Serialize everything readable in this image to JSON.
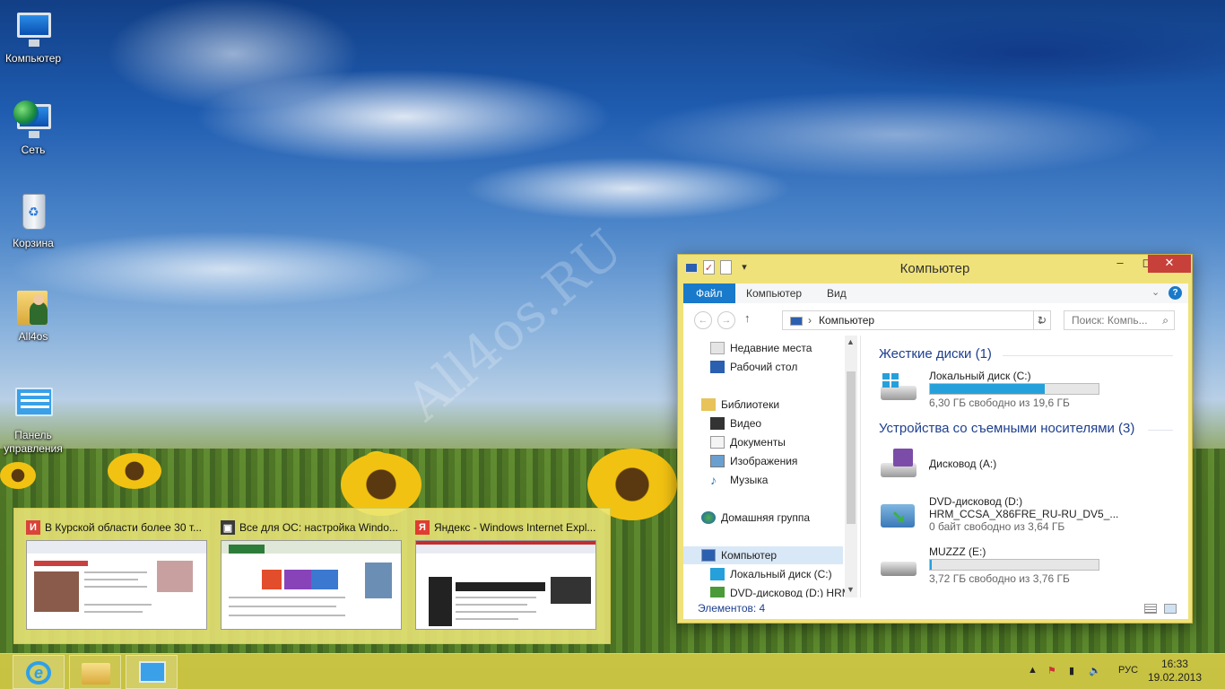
{
  "desktop": {
    "icons": [
      {
        "label": "Компьютер"
      },
      {
        "label": "Сеть"
      },
      {
        "label": "Корзина"
      },
      {
        "label": "All4os"
      },
      {
        "label": "Панель управления"
      }
    ],
    "watermark": "All4os.RU"
  },
  "thumbnails": [
    {
      "title": "В Курской области более 30 т...",
      "icon": "news-icon",
      "icon_color": "#d9433a"
    },
    {
      "title": "Все для ОС: настройка Windo...",
      "icon": "monitor-icon",
      "icon_color": "#3a3a3a"
    },
    {
      "title": "Яндекс - Windows Internet Expl...",
      "icon": "yandex-icon",
      "icon_color": "#e03c31"
    }
  ],
  "explorer": {
    "title": "Компьютер",
    "ribbon_tabs": [
      "Файл",
      "Компьютер",
      "Вид"
    ],
    "address": "Компьютер",
    "search_placeholder": "Поиск: Компь...",
    "nav": [
      {
        "label": "Недавние места"
      },
      {
        "label": "Рабочий стол"
      },
      {
        "label": "Библиотеки"
      },
      {
        "label": "Видео"
      },
      {
        "label": "Документы"
      },
      {
        "label": "Изображения"
      },
      {
        "label": "Музыка"
      },
      {
        "label": "Домашняя группа"
      },
      {
        "label": "Компьютер"
      },
      {
        "label": "Локальный диск (C:)"
      },
      {
        "label": "DVD-дисковод (D:) HRM"
      }
    ],
    "groups": {
      "hard": "Жесткие диски (1)",
      "removable": "Устройства со съемными носителями (3)"
    },
    "drives": [
      {
        "name": "Локальный диск (C:)",
        "free": "6,30 ГБ свободно из 19,6 ГБ",
        "used_fraction": 0.68
      },
      {
        "name": "Дисковод (A:)"
      },
      {
        "name": "DVD-дисковод (D:)",
        "label": "HRM_CCSA_X86FRE_RU-RU_DV5_...",
        "free": "0 байт свободно из 3,64 ГБ"
      },
      {
        "name": "MUZZZ (E:)",
        "free": "3,72 ГБ свободно из 3,76 ГБ",
        "used_fraction": 0.01
      }
    ],
    "status": "Элементов: 4"
  },
  "taskbar": {
    "lang": "РУС",
    "time": "16:33",
    "date": "19.02.2013"
  },
  "colors": {
    "accent": "#1979ca",
    "window_frame": "#f0e27a",
    "progress": "#26a0da",
    "close": "#c7403a"
  }
}
